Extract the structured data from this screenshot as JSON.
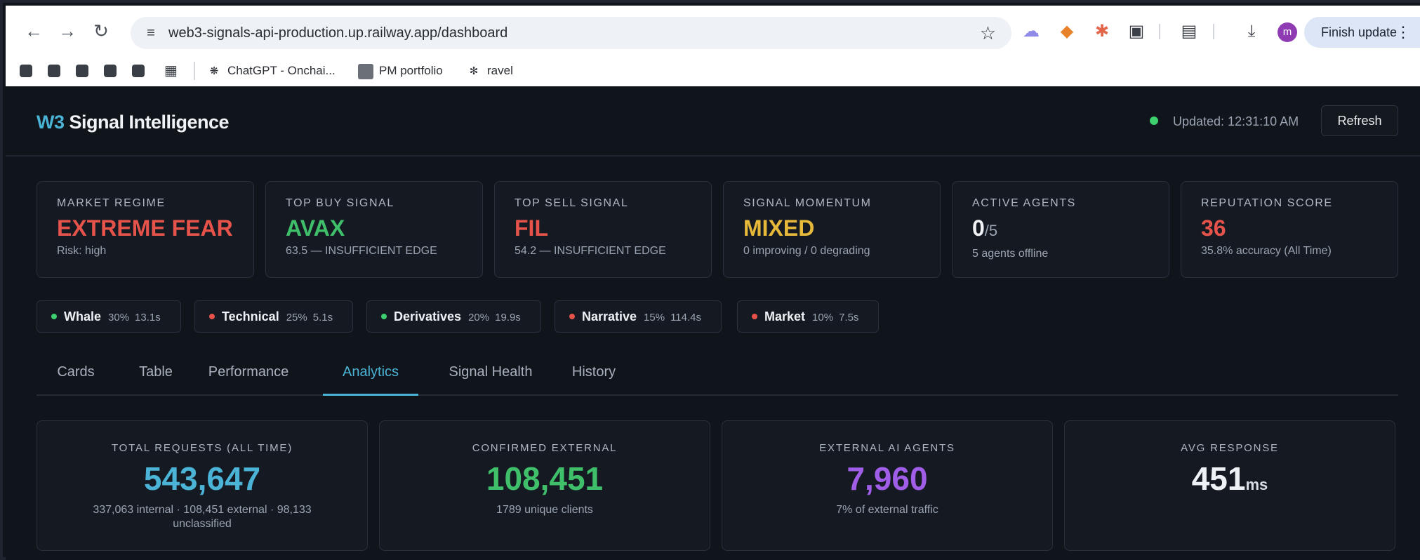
{
  "browser": {
    "url": "web3-signals-api-production.up.railway.app/dashboard",
    "finish_update_label": "Finish update",
    "avatar_letter": "m",
    "bookmarks": [
      {
        "label": "ChatGPT - Onchai..."
      },
      {
        "label": "PM portfolio"
      },
      {
        "label": "ravel"
      }
    ]
  },
  "header": {
    "brand_prefix": "W3",
    "brand_name": "Signal Intelligence",
    "updated": "Updated: 12:31:10 AM",
    "refresh_label": "Refresh"
  },
  "stats": [
    {
      "label": "MARKET REGIME",
      "value": "EXTREME FEAR",
      "color": "#e5534b",
      "sub": "Risk: high"
    },
    {
      "label": "TOP BUY SIGNAL",
      "value": "AVAX",
      "color": "#3fbf6a",
      "sub": "63.5 — INSUFFICIENT EDGE"
    },
    {
      "label": "TOP SELL SIGNAL",
      "value": "FIL",
      "color": "#e5534b",
      "sub": "54.2 — INSUFFICIENT EDGE"
    },
    {
      "label": "SIGNAL MOMENTUM",
      "value": "MIXED",
      "color": "#e6b93a",
      "sub": "0 improving / 0 degrading"
    },
    {
      "label": "ACTIVE AGENTS",
      "value": "0",
      "denom": "/5",
      "color": "#f1f3f6",
      "sub": "5 agents offline"
    },
    {
      "label": "REPUTATION SCORE",
      "value": "36",
      "color": "#e5534b",
      "sub": "35.8% accuracy (All Time)"
    }
  ],
  "agents": [
    {
      "name": "Whale",
      "weight": "30%",
      "latency": "13.1s",
      "status_color": "#3ecf6e"
    },
    {
      "name": "Technical",
      "weight": "25%",
      "latency": "5.1s",
      "status_color": "#e5534b"
    },
    {
      "name": "Derivatives",
      "weight": "20%",
      "latency": "19.9s",
      "status_color": "#3ecf6e"
    },
    {
      "name": "Narrative",
      "weight": "15%",
      "latency": "114.4s",
      "status_color": "#e5534b"
    },
    {
      "name": "Market",
      "weight": "10%",
      "latency": "7.5s",
      "status_color": "#e5534b"
    }
  ],
  "tabs": [
    {
      "label": "Cards"
    },
    {
      "label": "Table"
    },
    {
      "label": "Performance"
    },
    {
      "label": "Analytics",
      "active": true
    },
    {
      "label": "Signal Health"
    },
    {
      "label": "History"
    }
  ],
  "metrics": [
    {
      "label": "TOTAL REQUESTS (ALL TIME)",
      "value": "543,647",
      "color": "#4bb3d6",
      "sub": "337,063 internal · 108,451 external · 98,133 unclassified"
    },
    {
      "label": "CONFIRMED EXTERNAL",
      "value": "108,451",
      "color": "#3fbf6a",
      "sub": "1789 unique clients"
    },
    {
      "label": "EXTERNAL AI AGENTS",
      "value": "7,960",
      "color": "#a05de8",
      "sub": "7% of external traffic"
    },
    {
      "label": "AVG RESPONSE",
      "value": "451",
      "unit": "ms",
      "color": "#eef1f5",
      "sub": ""
    }
  ]
}
